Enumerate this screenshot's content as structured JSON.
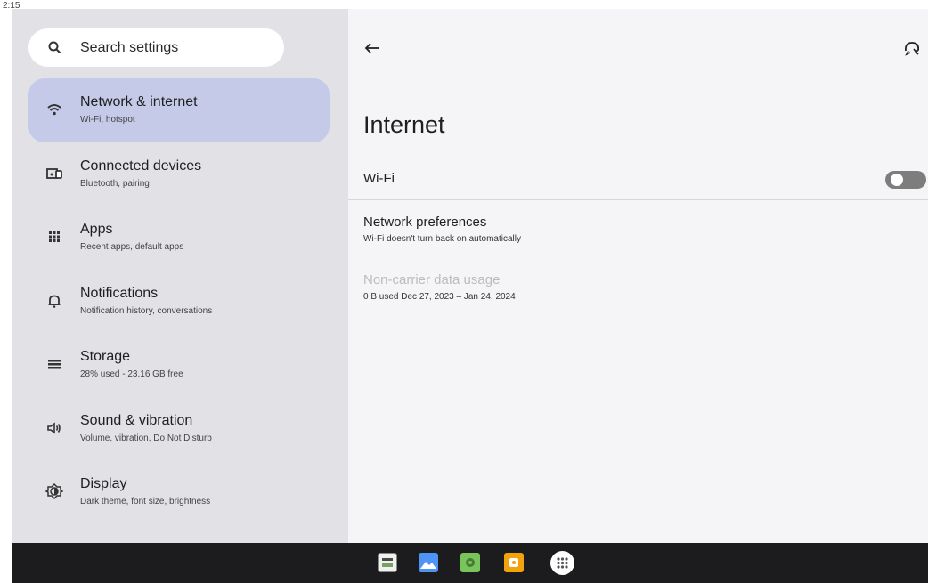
{
  "status_bar": {
    "time": "2:15"
  },
  "search": {
    "label": "Search settings"
  },
  "sidebar": {
    "items": [
      {
        "title": "Network & internet",
        "subtitle": "Wi-Fi, hotspot",
        "icon": "wifi-icon",
        "selected": true
      },
      {
        "title": "Connected devices",
        "subtitle": "Bluetooth, pairing",
        "icon": "devices-icon"
      },
      {
        "title": "Apps",
        "subtitle": "Recent apps, default apps",
        "icon": "apps-grid-icon"
      },
      {
        "title": "Notifications",
        "subtitle": "Notification history, conversations",
        "icon": "bell-icon"
      },
      {
        "title": "Storage",
        "subtitle": "28% used - 23.16 GB free",
        "icon": "storage-icon"
      },
      {
        "title": "Sound & vibration",
        "subtitle": "Volume, vibration, Do Not Disturb",
        "icon": "speaker-icon"
      },
      {
        "title": "Display",
        "subtitle": "Dark theme, font size, brightness",
        "icon": "brightness-icon"
      }
    ]
  },
  "main": {
    "title": "Internet",
    "wifi": {
      "label": "Wi-Fi",
      "enabled": false
    },
    "network_preferences": {
      "title": "Network preferences",
      "subtitle": "Wi-Fi doesn't turn back on automatically"
    },
    "data_usage": {
      "title": "Non-carrier data usage",
      "subtitle": "0 B used Dec 27, 2023 – Jan 24, 2024"
    }
  },
  "colors": {
    "selected_bg": "#c5cae9",
    "sidebar_bg": "#e2e2e6",
    "content_bg": "#f5f5f8",
    "taskbar_bg": "#1c1c1e"
  },
  "taskbar": {
    "icons": [
      "spreadsheet-app-icon",
      "gallery-app-icon",
      "android-app-icon",
      "orange-app-icon",
      "app-drawer-icon"
    ]
  }
}
